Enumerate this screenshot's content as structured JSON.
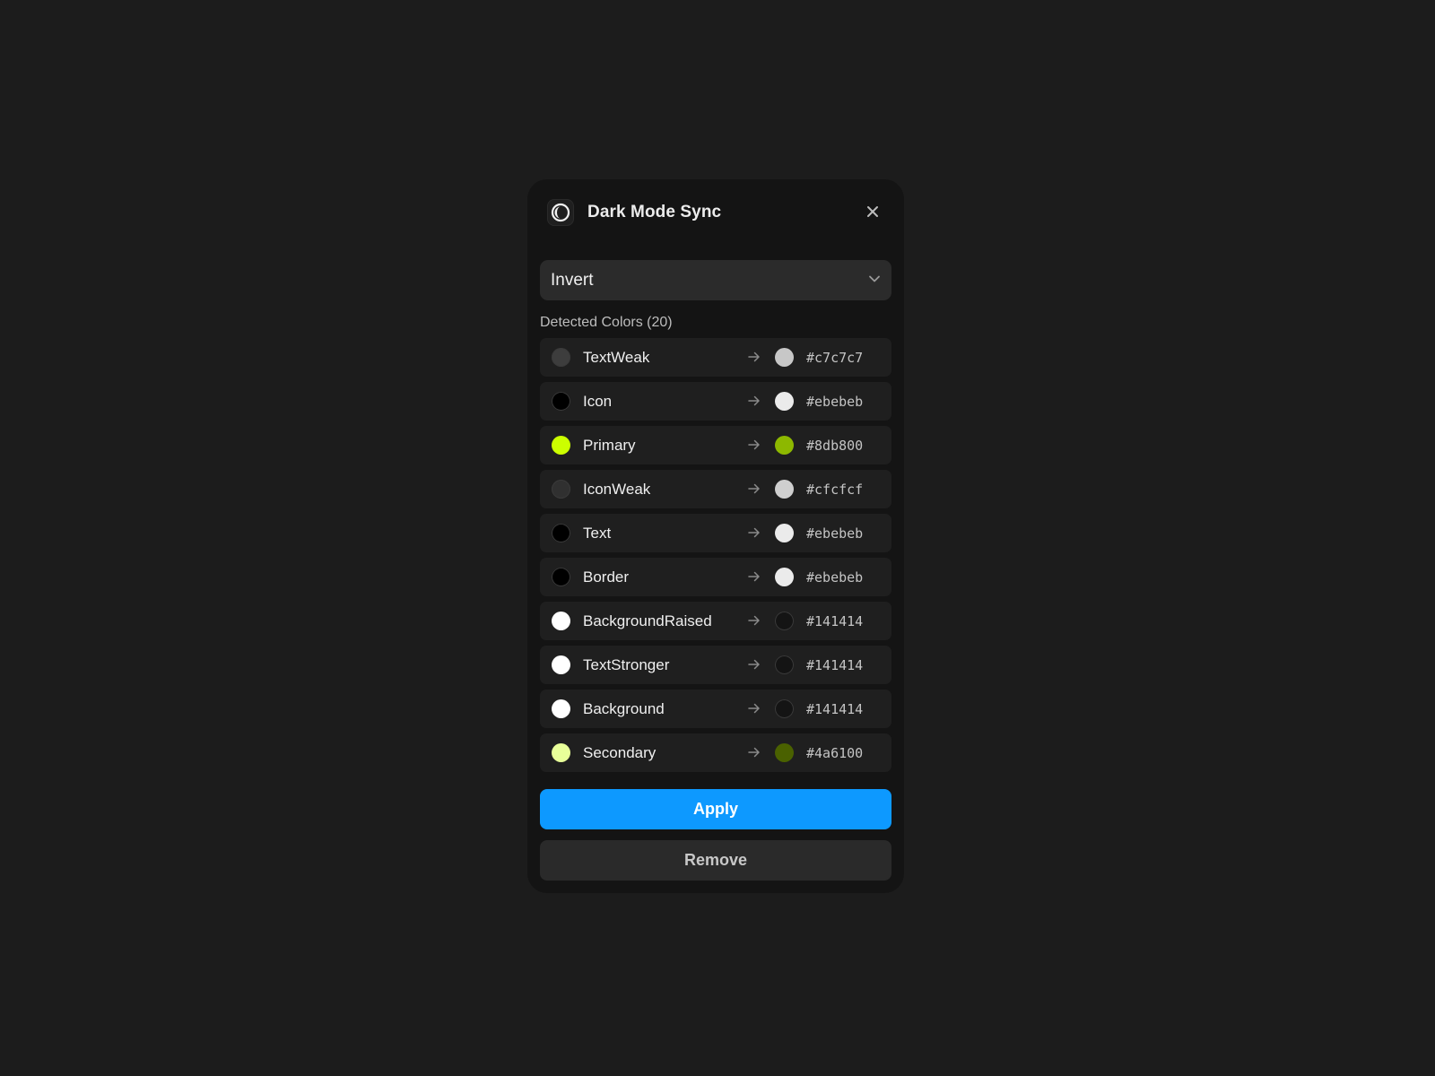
{
  "header": {
    "title": "Dark Mode Sync",
    "app_icon": "half-moon-contrast-icon",
    "close_icon": "close-icon"
  },
  "mode_select": {
    "value": "Invert",
    "icon": "chevron-down-icon"
  },
  "detected": {
    "label": "Detected Colors (20)"
  },
  "colors": {
    "swatch_ring": "#3a3a3a",
    "arrow": "#8a8a8a",
    "accent": "#0d99ff"
  },
  "rows": [
    {
      "name": "TextWeak",
      "from": "#3d3d3d",
      "to": "#c7c7c7",
      "hex": "#c7c7c7"
    },
    {
      "name": "Icon",
      "from": "#000000",
      "to": "#ebebeb",
      "hex": "#ebebeb"
    },
    {
      "name": "Primary",
      "from": "#ccff00",
      "to": "#8db800",
      "hex": "#8db800"
    },
    {
      "name": "IconWeak",
      "from": "#303030",
      "to": "#cfcfcf",
      "hex": "#cfcfcf"
    },
    {
      "name": "Text",
      "from": "#000000",
      "to": "#ebebeb",
      "hex": "#ebebeb"
    },
    {
      "name": "Border",
      "from": "#000000",
      "to": "#ebebeb",
      "hex": "#ebebeb"
    },
    {
      "name": "BackgroundRaised",
      "from": "#ffffff",
      "to": "#141414",
      "hex": "#141414"
    },
    {
      "name": "TextStronger",
      "from": "#ffffff",
      "to": "#141414",
      "hex": "#141414"
    },
    {
      "name": "Background",
      "from": "#ffffff",
      "to": "#141414",
      "hex": "#141414"
    },
    {
      "name": "Secondary",
      "from": "#e8ff99",
      "to": "#4a6100",
      "hex": "#4a6100"
    }
  ],
  "actions": {
    "apply_label": "Apply",
    "remove_label": "Remove"
  }
}
